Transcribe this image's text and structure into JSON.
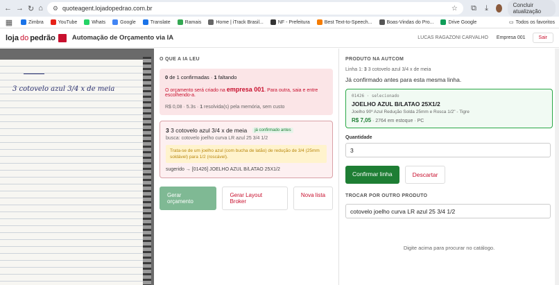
{
  "browser": {
    "url": "quoteagent.lojadopedrao.com.br",
    "update_label": "Concluir atualização"
  },
  "bookmarks": [
    {
      "label": "Zimbra",
      "color": "#1a73e8"
    },
    {
      "label": "YouTube",
      "color": "#e62117"
    },
    {
      "label": "Whats",
      "color": "#25d366"
    },
    {
      "label": "Google",
      "color": "#4285f4"
    },
    {
      "label": "Translate",
      "color": "#1a73e8"
    },
    {
      "label": "Ramais",
      "color": "#34a853"
    },
    {
      "label": "Home | iTrack Brasil...",
      "color": "#666666"
    },
    {
      "label": "NF - Prefeitura",
      "color": "#333333"
    },
    {
      "label": "Best Text-to-Speech...",
      "color": "#f57c00"
    },
    {
      "label": "Boas-Vindas do Pro...",
      "color": "#555555"
    },
    {
      "label": "Drive Google",
      "color": "#0f9d58"
    }
  ],
  "bookmarks_all": "Todos os favoritos",
  "header": {
    "logo_loja": "loja",
    "logo_do": "do",
    "logo_pedrao": "pedrão",
    "title": "Automação de Orçamento via IA",
    "user": "LUCAS RAGAZONI CARVALHO",
    "company": "Empresa 001",
    "logout": "Sair"
  },
  "image": {
    "handwriting": "3 cotovelo azul 3/4 x de meia"
  },
  "middle": {
    "title": "O QUE A IA LEU",
    "confirmed": "0",
    "confirmed_of": " de 1 confirmadas · ",
    "missing": "1",
    "missing_label": " faltando",
    "warn_pre": "O orçamento será criado na ",
    "warn_company": "empresa 001",
    "warn_post": ". Para outra, saia e entre escolhendo-a.",
    "meta_pre": "R$ 0,08 · 5.3s · ",
    "meta_num": "1",
    "meta_post": " resolvida(s) pela memória, sem custo",
    "item_qty": "3",
    "item_text": " 3 cotovelo azul 3/4 x de meia",
    "item_badge": "já confirmado antes",
    "item_search": "busca: cotovelo joelho curva LR azul 25 3/4 1/2",
    "item_note": "Trata-se de um joelho azul (com bucha de latão) de redução de 3/4 (25mm soldável) para 1/2 (roscável).",
    "item_suggested": "sugerido → [01426] JOELHO AZUL B/LATAO 25X1/2",
    "btn_generate": "Gerar orçamento",
    "btn_layout": "Gerar Layout Broker",
    "btn_new": "Nova lista"
  },
  "right": {
    "title": "PRODUTO NA AUTCOM",
    "line_pre": "Linha 1: ",
    "line_qty": "3",
    "line_post": " 3 cotovelo azul 3/4 x de meia",
    "confirmed_msg": "Já confirmado antes para esta mesma linha.",
    "sel_code": "01426 · selecionado",
    "sel_name": "JOELHO AZUL B/LATAO 25X1/2",
    "sel_desc": "Joelho 90º Azul Redução Solda 25mm e Rosca 1/2\" - Tigre",
    "sel_price": "R$ 7,05",
    "sel_stock": " · 2764 em estoque · PC",
    "qty_label": "Quantidade",
    "qty_value": "3",
    "btn_confirm": "Confirmar linha",
    "btn_discard": "Descartar",
    "swap_title": "TROCAR POR OUTRO PRODUTO",
    "search_value": "cotovelo joelho curva LR azul 25 3/4 1/2",
    "empty_msg": "Digite acima para procurar no catálogo."
  }
}
